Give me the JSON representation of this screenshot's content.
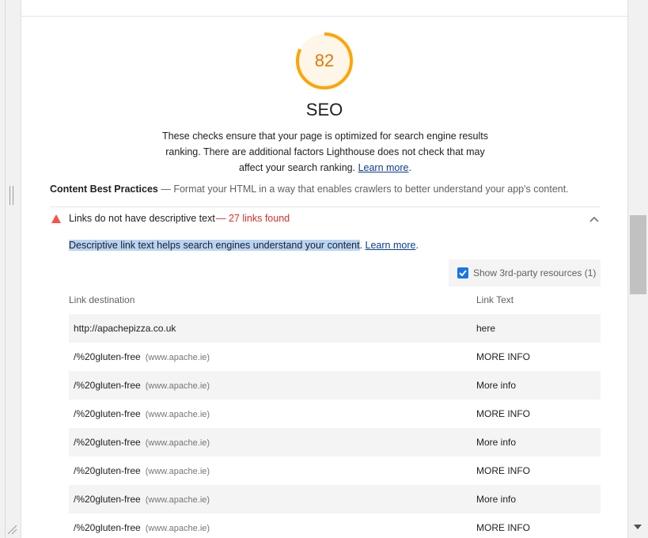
{
  "category": {
    "score": "82",
    "title": "SEO",
    "description": "These checks ensure that your page is optimized for search engine results ranking. There are additional factors Lighthouse does not check that may affect your search ranking.",
    "learn_more": "Learn more",
    "score_color": "#ffa400"
  },
  "group": {
    "title": "Content Best Practices",
    "description": "— Format your HTML in a way that enables crawlers to better understand your app's content."
  },
  "audit": {
    "title": "Links do not have descriptive text",
    "display_value": "— 27 links found",
    "description": "Descriptive link text helps search engines understand your content",
    "learn_more": "Learn more",
    "status": "fail",
    "fail_color": "#ff4e42"
  },
  "third_party": {
    "label": "Show 3rd-party resources (1)",
    "checked": true
  },
  "table": {
    "headers": [
      "Link destination",
      "Link Text"
    ],
    "rows": [
      {
        "dest": "http://apachepizza.co.uk",
        "host": "",
        "text": "here"
      },
      {
        "dest": "/%20gluten-free",
        "host": "(www.apache.ie)",
        "text": "MORE INFO"
      },
      {
        "dest": "/%20gluten-free",
        "host": "(www.apache.ie)",
        "text": "More info"
      },
      {
        "dest": "/%20gluten-free",
        "host": "(www.apache.ie)",
        "text": "MORE INFO"
      },
      {
        "dest": "/%20gluten-free",
        "host": "(www.apache.ie)",
        "text": "More info"
      },
      {
        "dest": "/%20gluten-free",
        "host": "(www.apache.ie)",
        "text": "MORE INFO"
      },
      {
        "dest": "/%20gluten-free",
        "host": "(www.apache.ie)",
        "text": "More info"
      },
      {
        "dest": "/%20gluten-free",
        "host": "(www.apache.ie)",
        "text": "MORE INFO"
      }
    ]
  }
}
